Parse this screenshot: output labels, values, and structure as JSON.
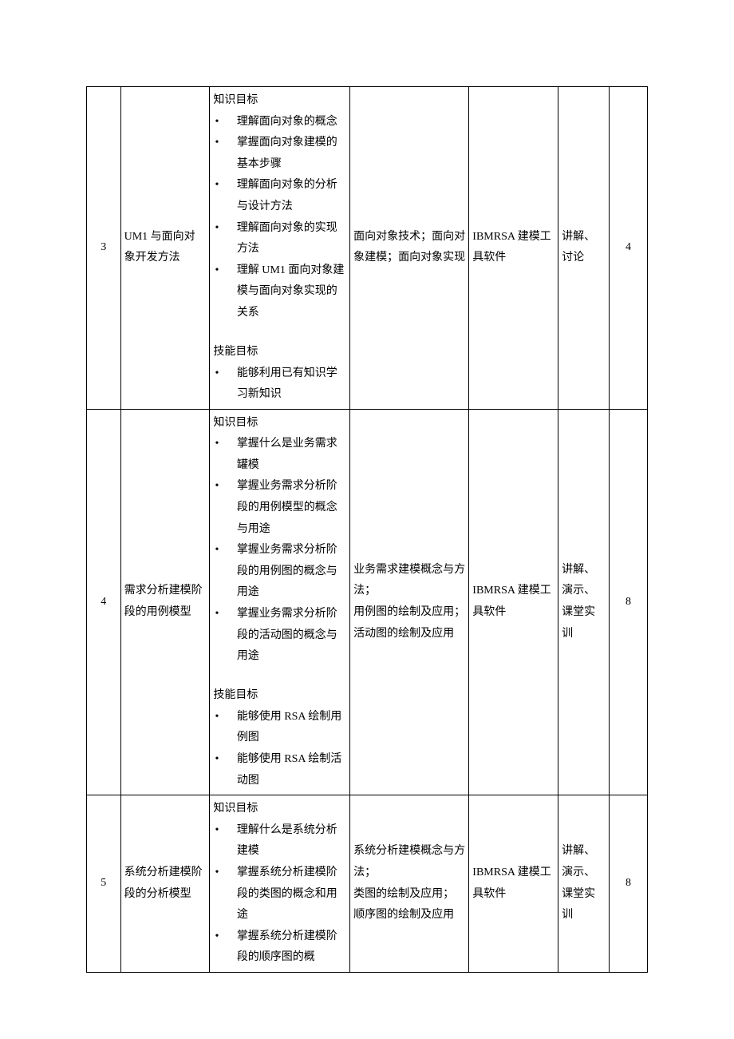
{
  "rows": [
    {
      "num": "3",
      "topic": "UM1 与面向对象开发方法",
      "goals_knowledge_label": "知识目标",
      "goals_knowledge_items": [
        "理解面向对象的概念",
        "掌握面向对象建模的基本步骤",
        "理解面向对象的分析与设计方法",
        "理解面向对象的实现方法",
        "理解 UM1 面向对象建模与面向对象实现的关系"
      ],
      "goals_skill_label": "技能目标",
      "goals_skill_items": [
        "能够利用已有知识学习新知识"
      ],
      "key_points": "面向对象技术；面向对象建模；面向对象实现",
      "tools": "IBMRSA 建模工具软件",
      "methods": "讲解、讨论",
      "hours": "4"
    },
    {
      "num": "4",
      "topic": "需求分析建模阶段的用例模型",
      "goals_knowledge_label": "知识目标",
      "goals_knowledge_items": [
        "掌握什么是业务需求罐模",
        "掌握业务需求分析阶段的用例模型的概念与用途",
        "掌握业务需求分析阶段的用例图的概念与用途",
        "掌握业务需求分析阶段的活动图的概念与用途"
      ],
      "goals_skill_label": "技能目标",
      "goals_skill_items": [
        "能够使用 RSA 绘制用例图",
        "能够使用 RSA 绘制活动图"
      ],
      "key_points": "业务需求建模概念与方法；\n用例图的绘制及应用；\n活动图的绘制及应用",
      "tools": "IBMRSA 建模工具软件",
      "methods": "讲解、演示、课堂实训",
      "hours": "8"
    },
    {
      "num": "5",
      "topic": "系统分析建模阶段的分析模型",
      "goals_knowledge_label": "知识目标",
      "goals_knowledge_items": [
        "理解什么是系统分析建模",
        "掌握系统分析建模阶段的类图的概念和用途",
        "掌握系统分析建模阶段的顺序图的概"
      ],
      "goals_skill_label": "",
      "goals_skill_items": [],
      "key_points": "系统分析建模概念与方法；\n类图的绘制及应用；\n顺序图的绘制及应用",
      "tools": "IBMRSA 建模工具软件",
      "methods": "讲解、演示、课堂实训",
      "hours": "8"
    }
  ]
}
